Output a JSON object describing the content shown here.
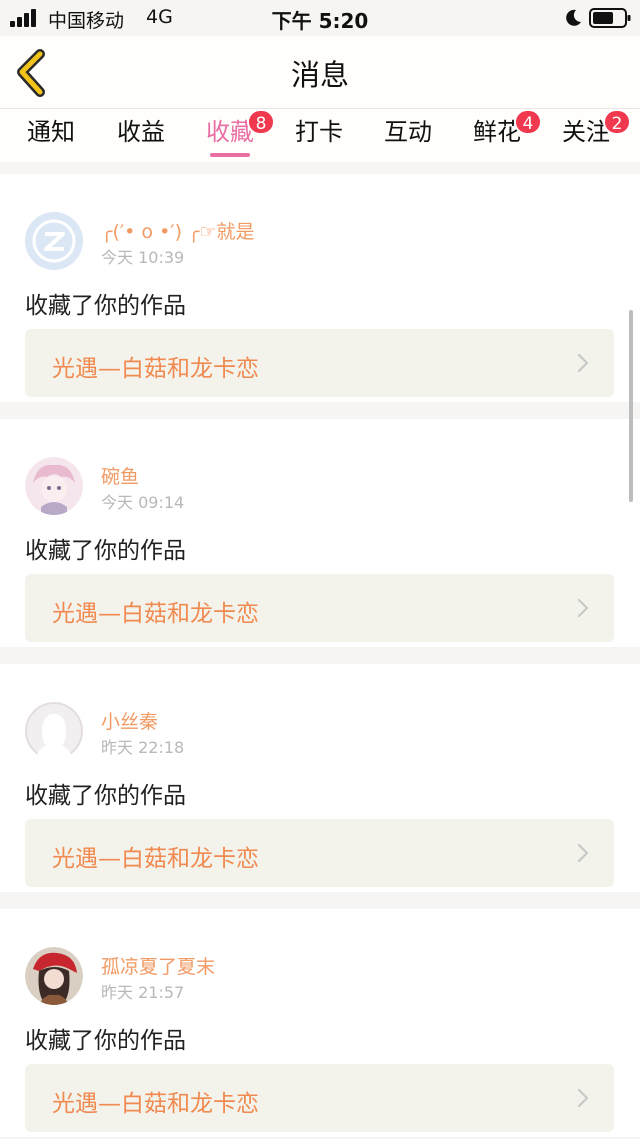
{
  "status_bar": {
    "carrier": "中国移动",
    "network": "4G",
    "time": "下午 5:20"
  },
  "header": {
    "title": "消息",
    "back_icon": "chevron-left-icon"
  },
  "tabs": [
    {
      "label": "通知",
      "badge": null,
      "active": false
    },
    {
      "label": "收益",
      "badge": null,
      "active": false
    },
    {
      "label": "收藏",
      "badge": "8",
      "active": true
    },
    {
      "label": "打卡",
      "badge": null,
      "active": false
    },
    {
      "label": "互动",
      "badge": null,
      "active": false
    },
    {
      "label": "鲜花",
      "badge": "4",
      "active": false
    },
    {
      "label": "关注",
      "badge": "2",
      "active": false
    }
  ],
  "messages": [
    {
      "username": "╭(′• o •′) ╭☞就是",
      "time": "今天 10:39",
      "action": "收藏了你的作品",
      "work_title": "光遇—白菇和龙卡恋"
    },
    {
      "username": "碗鱼",
      "time": "今天 09:14",
      "action": "收藏了你的作品",
      "work_title": "光遇—白菇和龙卡恋"
    },
    {
      "username": "小丝秦",
      "time": "昨天 22:18",
      "action": "收藏了你的作品",
      "work_title": "光遇—白菇和龙卡恋"
    },
    {
      "username": "孤凉夏了夏末",
      "time": "昨天 21:57",
      "action": "收藏了你的作品",
      "work_title": "光遇—白菇和龙卡恋"
    }
  ],
  "colors": {
    "accent_pink": "#e86ea4",
    "badge_red": "#f0384e",
    "username_orange": "#f19a63",
    "work_title_orange": "#f08a50",
    "back_icon_yellow": "#f2c318"
  }
}
